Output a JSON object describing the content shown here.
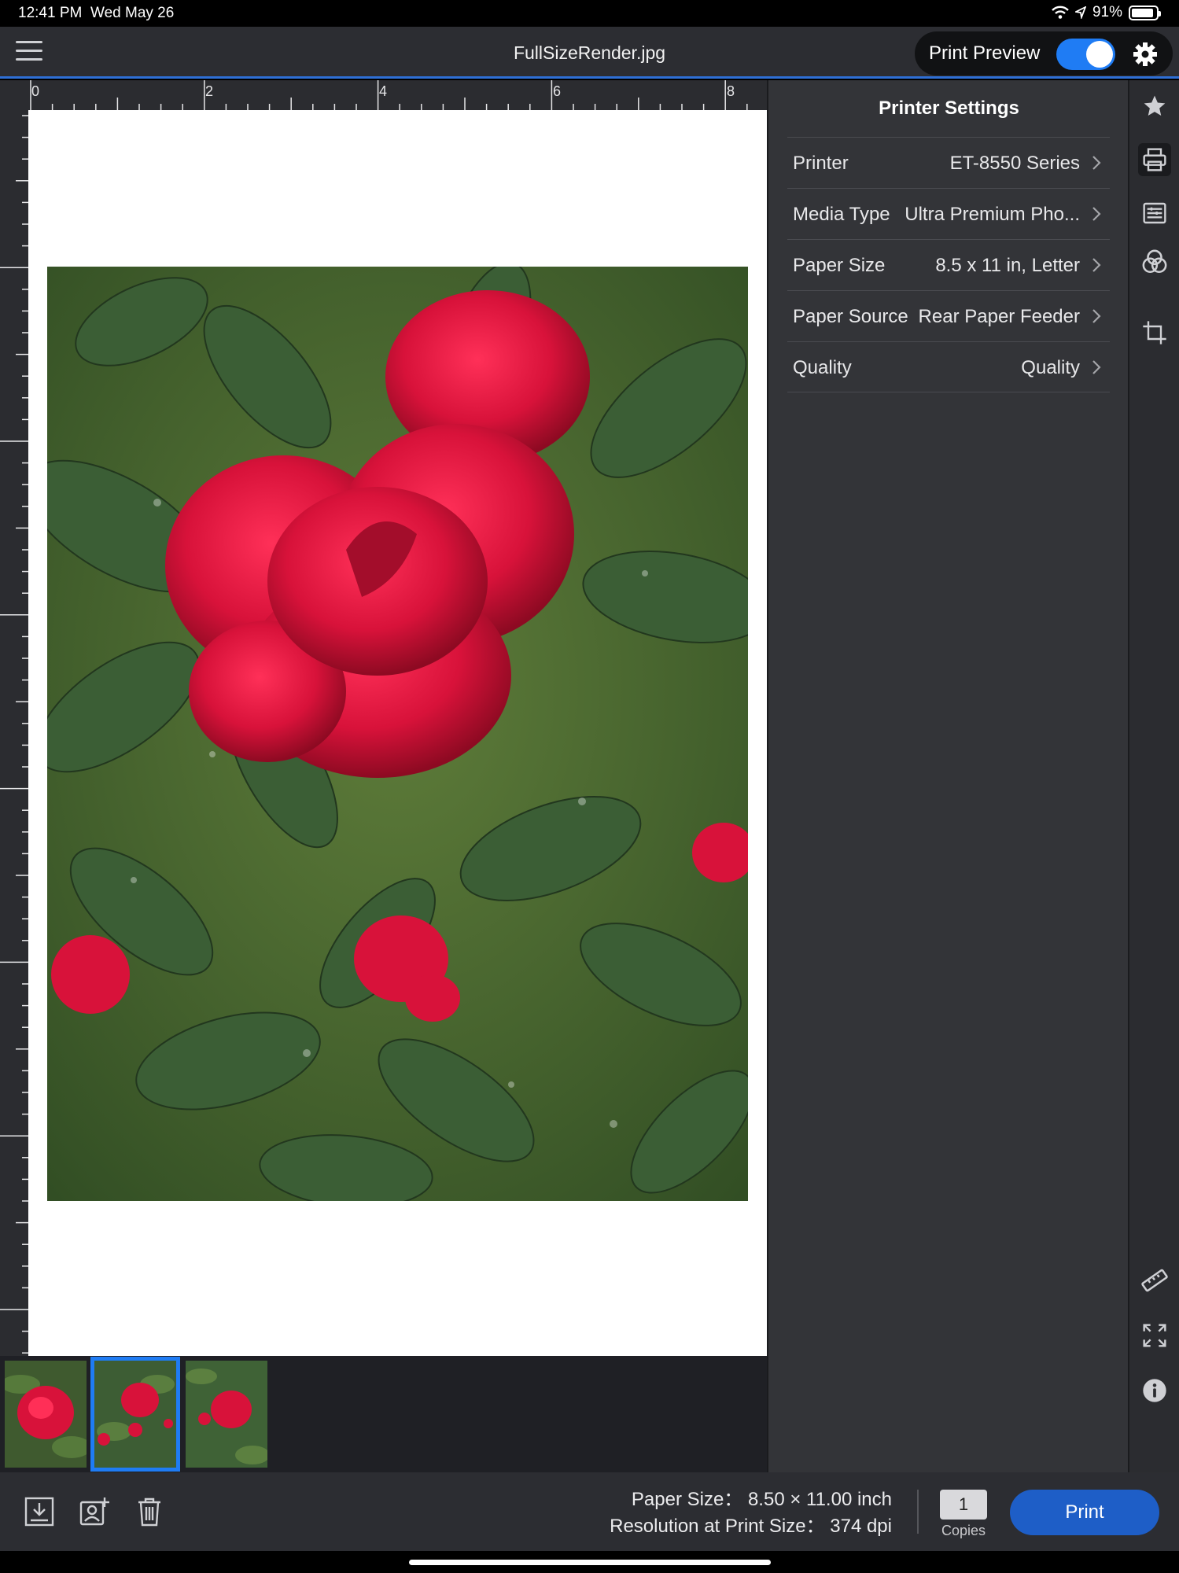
{
  "status_bar": {
    "time": "12:41 PM",
    "date": "Wed May 26",
    "battery": "91%",
    "battery_level": 0.91
  },
  "header": {
    "title": "FullSizeRender.jpg",
    "preview_label": "Print Preview",
    "preview_on": true
  },
  "ruler": {
    "labels": [
      "0",
      "2",
      "4",
      "6",
      "8"
    ]
  },
  "settings": {
    "title": "Printer Settings",
    "rows": [
      {
        "label": "Printer",
        "value": "ET-8550 Series"
      },
      {
        "label": "Media Type",
        "value": "Ultra Premium Pho..."
      },
      {
        "label": "Paper Size",
        "value": "8.5 x 11 in, Letter"
      },
      {
        "label": "Paper Source",
        "value": "Rear Paper Feeder"
      },
      {
        "label": "Quality",
        "value": "Quality"
      }
    ]
  },
  "thumbnails": {
    "count": 3,
    "selected_index": 1
  },
  "rail_icons": [
    "star-icon",
    "printer-icon",
    "layout-settings-icon",
    "color-adjust-icon",
    "crop-icon",
    "ruler-icon",
    "fit-expand-icon",
    "info-icon"
  ],
  "footer": {
    "paper_size": "Paper Size： 8.50 × 11.00 inch",
    "resolution": "Resolution at Print Size： 374 dpi",
    "copies_value": "1",
    "copies_label": "Copies",
    "print_label": "Print"
  },
  "colors": {
    "accent": "#1f7cf4",
    "print_button": "#1e5ec7",
    "panel": "#333438",
    "rose": "#d8123a"
  }
}
